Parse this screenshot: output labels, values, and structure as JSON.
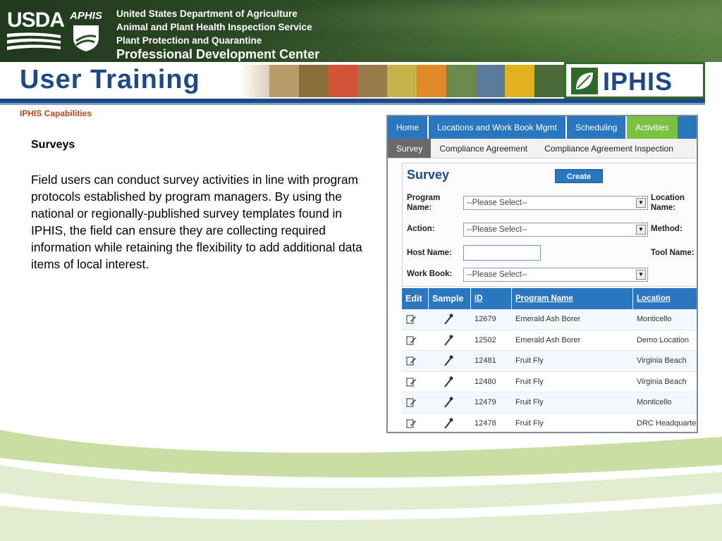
{
  "header": {
    "usda_logo_text": "USDA",
    "aphis_logo_text": "APHIS",
    "agency_lines": [
      "United States Department of Agriculture",
      "Animal and Plant Health Inspection Service",
      "Plant Protection and Quarantine",
      "Professional Development Center"
    ]
  },
  "title": "User Training",
  "iphis_logo_text": "IPHIS",
  "section_label": "IPHIS Capabilities",
  "content": {
    "heading": "Surveys",
    "paragraph": "Field users can conduct survey activities in line with program protocols established by program managers. By using the national or regionally-published survey templates found in IPHIS, the field can ensure they are collecting required information while retaining the flexibility to add additional data items of local interest."
  },
  "app": {
    "top_tabs": [
      "Home",
      "Locations and Work Book Mgmt",
      "Scheduling",
      "Activities"
    ],
    "sub_tabs": [
      "Survey",
      "Compliance Agreement",
      "Compliance Agreement Inspection"
    ],
    "form": {
      "title": "Survey",
      "create_label": "Create",
      "program_label": "Program Name:",
      "action_label": "Action:",
      "host_label": "Host Name:",
      "workbook_label": "Work Book:",
      "location_label": "Location Name:",
      "method_label": "Method:",
      "tool_label": "Tool Name:",
      "select_placeholder": "--Please Select--"
    },
    "grid": {
      "headers": [
        "Edit",
        "Sample",
        "ID",
        "Program Name",
        "Location"
      ],
      "rows": [
        {
          "id": "12679",
          "program": "Emerald Ash Borer",
          "location": "Monticello"
        },
        {
          "id": "12502",
          "program": "Emerald Ash Borer",
          "location": "Demo Location"
        },
        {
          "id": "12481",
          "program": "Fruit Fly",
          "location": "Virginia Beach"
        },
        {
          "id": "12480",
          "program": "Fruit Fly",
          "location": "Virginia Beach"
        },
        {
          "id": "12479",
          "program": "Fruit Fly",
          "location": "Monticello"
        },
        {
          "id": "12478",
          "program": "Fruit Fly",
          "location": "DRC Headquarters"
        }
      ]
    }
  },
  "colors": {
    "brand_blue": "#1d4a86",
    "nav_blue": "#2a77c0",
    "active_green": "#7cc242",
    "section_orange": "#c0461a",
    "swoosh_green": "#c9dea3"
  },
  "icons": [
    "edit-icon",
    "sample-icon"
  ]
}
